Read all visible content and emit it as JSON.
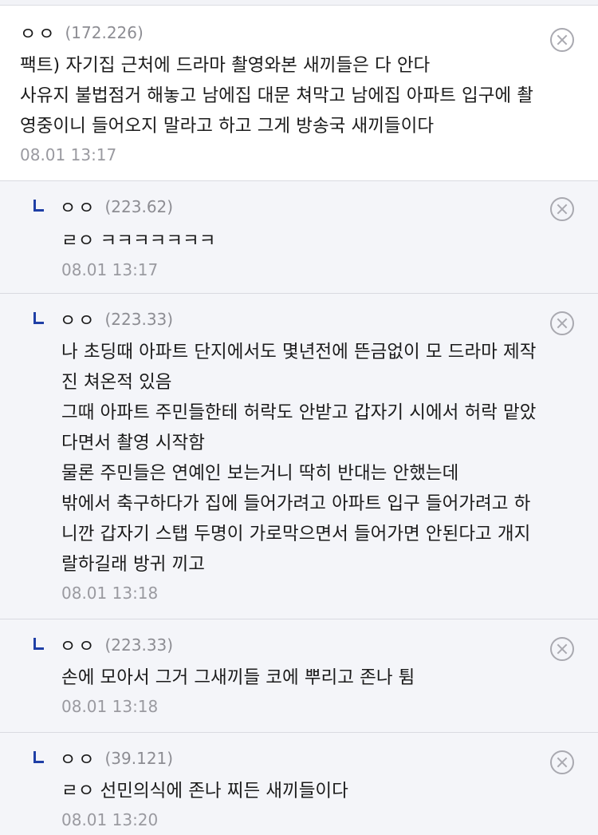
{
  "comments": [
    {
      "name": "ㅇㅇ",
      "ip": "(172.226)",
      "lines": [
        "팩트) 자기집 근처에 드라마 촬영와본 새끼들은 다 안다",
        "사유지 불법점거 해놓고 남에집 대문 쳐막고 남에집 아파트 입구에 촬",
        "영중이니 들어오지 말라고 하고 그게 방송국 새끼들이다"
      ],
      "time": "08.01 13:17"
    },
    {
      "name": "ㅇㅇ",
      "ip": "(223.62)",
      "lines": [
        "ㄹㅇ ㅋㅋㅋㅋㅋㅋㅋ"
      ],
      "time": "08.01 13:17"
    },
    {
      "name": "ㅇㅇ",
      "ip": "(223.33)",
      "lines": [
        "나 초딩때 아파트 단지에서도 몇년전에 뜬금없이 모 드라마 제작",
        "진 쳐온적 있음",
        "그때 아파트 주민들한테 허락도 안받고 갑자기 시에서 허락 맡았",
        "다면서 촬영 시작함",
        "물론 주민들은 연예인 보는거니 딱히 반대는 안했는데",
        "밖에서 축구하다가 집에 들어가려고 아파트 입구 들어가려고 하",
        "니깐 갑자기 스탭 두명이 가로막으면서 들어가면 안된다고 개지",
        "랄하길래 방귀 끼고"
      ],
      "time": "08.01 13:18"
    },
    {
      "name": "ㅇㅇ",
      "ip": "(223.33)",
      "lines": [
        "손에 모아서 그거 그새끼들 코에 뿌리고 존나 튐"
      ],
      "time": "08.01 13:18"
    },
    {
      "name": "ㅇㅇ",
      "ip": "(39.121)",
      "lines": [
        "ㄹㅇ 선민의식에 존나 찌든 새끼들이다"
      ],
      "time": "08.01 13:20"
    }
  ],
  "icons": {
    "delete": "close-circle-icon",
    "reply": "reply-arrow-icon"
  },
  "colors": {
    "reply_background": "#f4f5f9",
    "reply_marker": "#1f3fa6",
    "meta_text": "#8d8d93"
  }
}
